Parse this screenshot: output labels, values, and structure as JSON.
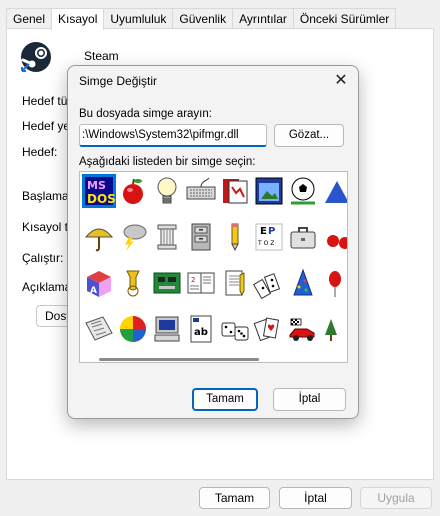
{
  "tabs": [
    {
      "label": "Genel"
    },
    {
      "label": "Kısayol"
    },
    {
      "label": "Uyumluluk"
    },
    {
      "label": "Güvenlik"
    },
    {
      "label": "Ayrıntılar"
    },
    {
      "label": "Önceki Sürümler"
    }
  ],
  "active_tab": "Kısayol",
  "shortcut": {
    "app_name": "Steam",
    "labels": {
      "target_type": "Hedef tür:",
      "target_location": "Hedef yer",
      "target": "Hedef:",
      "start_in": "Başlama y",
      "shortcut_key": "Kısayol tu",
      "run": "Çalıştır:",
      "comment": "Açıklama:"
    },
    "open_location_button": "Dosya"
  },
  "footer": {
    "ok": "Tamam",
    "cancel": "İptal",
    "apply": "Uygula"
  },
  "dialog": {
    "title": "Simge Değiştir",
    "close_glyph": "✕",
    "search_label": "Bu dosyada simge arayın:",
    "path_value": ":\\Windows\\System32\\pifmgr.dll",
    "browse_button": "Gözat...",
    "list_label": "Aşağıdaki listeden bir simge seçin:",
    "ok_button": "Tamam",
    "cancel_button": "İptal",
    "icons": [
      "ms-dos-icon",
      "apple-icon",
      "light-bulb-icon",
      "keyboard-icon",
      "book-icon",
      "window-picture-icon",
      "soccer-ball-icon",
      "blue-shape-icon",
      "umbrella-icon",
      "storm-cloud-icon",
      "column-icon",
      "file-cabinet-icon",
      "pencil-icon",
      "eye-chart-icon",
      "briefcase-icon",
      "cherries-icon",
      "alphabet-block-icon",
      "tuba-icon",
      "circuit-board-icon",
      "calendar-book-icon",
      "notepad-pencil-icon",
      "dominoes-icon",
      "party-hat-icon",
      "balloons-icon",
      "newspaper-icon",
      "beach-ball-icon",
      "computer-icon",
      "text-document-icon",
      "dice-icon",
      "playing-cards-icon",
      "race-car-icon",
      "trees-icon"
    ],
    "selected_icon": "ms-dos-icon",
    "icon_colors": {
      "selection": "#0078d7",
      "accent": "#0067c0"
    }
  }
}
